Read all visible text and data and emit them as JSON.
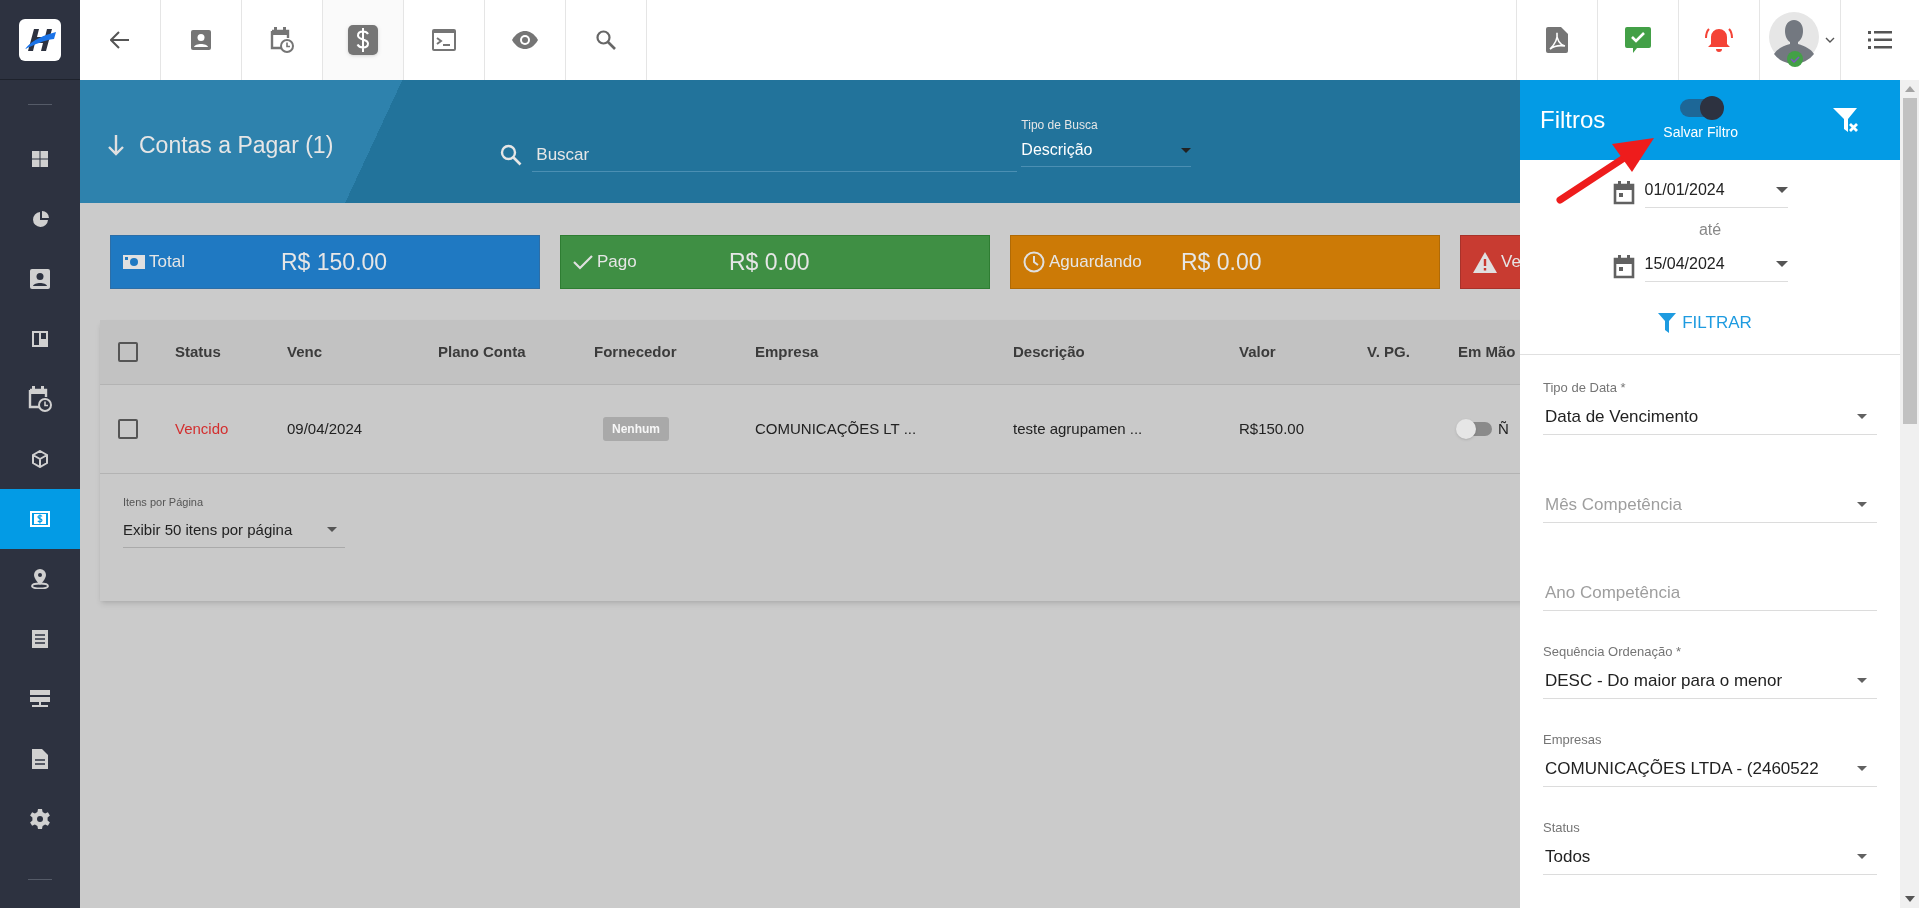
{
  "toolbar": [
    {
      "kind": "back",
      "selected": false
    },
    {
      "kind": "contact",
      "selected": false
    },
    {
      "kind": "calendar",
      "selected": false
    },
    {
      "kind": "dollar",
      "selected": true
    },
    {
      "kind": "terminal",
      "selected": false
    },
    {
      "kind": "eye",
      "selected": false
    },
    {
      "kind": "search",
      "selected": false
    }
  ],
  "sidebar": {
    "items": [
      {
        "kind": "grid",
        "selected": false
      },
      {
        "kind": "pie",
        "selected": false
      },
      {
        "kind": "contact",
        "selected": false
      },
      {
        "kind": "board",
        "selected": false
      },
      {
        "kind": "calendar",
        "selected": false
      },
      {
        "kind": "box",
        "selected": false
      },
      {
        "kind": "money",
        "selected": true
      },
      {
        "kind": "pin",
        "selected": false
      },
      {
        "kind": "receipt",
        "selected": false
      },
      {
        "kind": "server",
        "selected": false
      },
      {
        "kind": "file",
        "selected": false
      },
      {
        "kind": "gear",
        "selected": false
      }
    ]
  },
  "page_header": {
    "title": "Contas a Pagar (1)",
    "search": {
      "placeholder": "Buscar"
    },
    "search_type": {
      "label": "Tipo de Busca",
      "value": "Descrição"
    }
  },
  "summary_cards": [
    {
      "kind": "total",
      "label": "Total",
      "value": "R$ 150.00"
    },
    {
      "kind": "paid",
      "label": "Pago",
      "value": "R$ 0.00"
    },
    {
      "kind": "waiting",
      "label": "Aguardando",
      "value": "R$ 0.00"
    },
    {
      "kind": "overdue",
      "label": "Ve"
    }
  ],
  "table": {
    "select_all_checked": false,
    "columns": [
      "Status",
      "Venc",
      "Plano Conta",
      "Fornecedor",
      "Empresa",
      "Descrição",
      "Valor",
      "V. PG.",
      "Em Mão"
    ],
    "rows": [
      {
        "checked": false,
        "status": "Vencido",
        "venc": "09/04/2024",
        "fornecedor": "Nenhum",
        "empresa": "COMUNICAÇÕES LT ...",
        "descricao": "teste agrupamen ...",
        "valor": "R$150.00",
        "em_maos": {
          "on": false,
          "label": "Ñ"
        }
      }
    ]
  },
  "pagination": {
    "label": "Itens por Página",
    "value": "Exibir 50 itens por página"
  },
  "filters": {
    "title": "Filtros",
    "save_filter": {
      "label": "Salvar Filtro",
      "on": true
    },
    "date_from": "01/01/2024",
    "date_separator": "até",
    "date_to": "15/04/2024",
    "filter_button": "FILTRAR",
    "fields": [
      {
        "kind": "select",
        "label": "Tipo de Data *",
        "value": "Data de Vencimento"
      },
      {
        "kind": "select",
        "placeholder": "Mês Competência"
      },
      {
        "kind": "text",
        "placeholder": "Ano Competência"
      },
      {
        "kind": "select",
        "label": "Sequência Ordenação *",
        "value": "DESC - Do maior para o menor"
      },
      {
        "kind": "select",
        "label": "Empresas",
        "value": "COMUNICAÇÕES LTDA - (2460522"
      },
      {
        "kind": "select",
        "label": "Status",
        "value": "Todos"
      }
    ]
  }
}
